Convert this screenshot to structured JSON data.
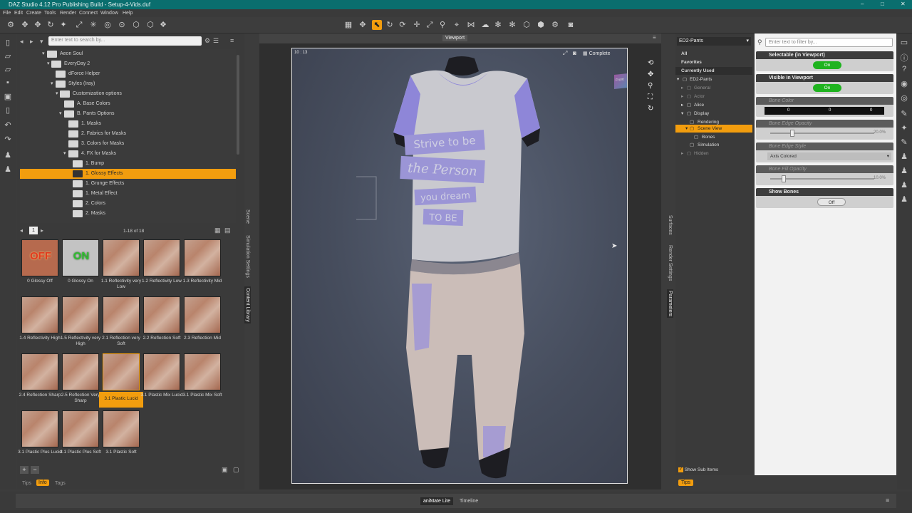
{
  "window": {
    "title": "DAZ Studio 4.12 Pro Publishing Build - Setup-4-Vids.duf",
    "controls": [
      "–",
      "□",
      "✕"
    ]
  },
  "menu": [
    "File",
    "Edit",
    "Create",
    "Tools",
    "Render",
    "Connect",
    "Window",
    "Help"
  ],
  "left_panel": {
    "search_placeholder": "Enter text to search by...",
    "tree": [
      {
        "label": "Aeon Soul",
        "indent": 1
      },
      {
        "label": "EveryDay 2",
        "indent": 2
      },
      {
        "label": "dForce Helper",
        "indent": 3
      },
      {
        "label": "Styles (Iray)",
        "indent": 3
      },
      {
        "label": "Customization options",
        "indent": 4
      },
      {
        "label": "A. Base Colors",
        "indent": 5
      },
      {
        "label": "B. Pants Options",
        "indent": 5
      },
      {
        "label": "1. Masks",
        "indent": 6
      },
      {
        "label": "2. Fabrics for Masks",
        "indent": 6
      },
      {
        "label": "3. Colors for Masks",
        "indent": 6
      },
      {
        "label": "4. FX for Masks",
        "indent": 6
      },
      {
        "label": "1. Bump",
        "indent": 7
      },
      {
        "label": "1. Glossy Effects",
        "indent": 7,
        "selected": true
      },
      {
        "label": "1. Grunge Effects",
        "indent": 7
      },
      {
        "label": "1. Metal Effect",
        "indent": 7
      },
      {
        "label": "2. Colors",
        "indent": 7
      },
      {
        "label": "2. Masks",
        "indent": 7
      }
    ],
    "page": "1",
    "count": "1-18 of 18",
    "thumbs": [
      {
        "label": "0 Glossy Off",
        "badge": "OFF",
        "kind": "off"
      },
      {
        "label": "0 Glossy On",
        "badge": "ON",
        "kind": "on"
      },
      {
        "label": "1.1 Reflectivity very Low"
      },
      {
        "label": "1.2 Reflectivity Low"
      },
      {
        "label": "1.3 Reflectivity Mid"
      },
      {
        "label": "1.4 Reflectivity High"
      },
      {
        "label": "1.5 Reflectivity very High"
      },
      {
        "label": "2.1 Reflection very Soft"
      },
      {
        "label": "2.2 Reflection Soft"
      },
      {
        "label": "2.3 Reflection Mid"
      },
      {
        "label": "2.4 Reflection Sharp"
      },
      {
        "label": "2.5 Reflection Very Sharp"
      },
      {
        "label": "3.1 Plastic Lucid",
        "selected": true
      },
      {
        "label": "3.1 Plastic Mix Lucid"
      },
      {
        "label": "3.1 Plastic Mix Soft"
      },
      {
        "label": "3.1 Plastic Plus Lucid"
      },
      {
        "label": "3.1 Plastic Plus Soft"
      },
      {
        "label": "3.1 Plastic Soft"
      }
    ],
    "bottom_tabs": [
      "Tips",
      "Info",
      "Tags"
    ],
    "vertical_tabs": [
      "Scene",
      "Simulation Settings",
      "Content Library"
    ]
  },
  "viewport": {
    "title": "Viewport",
    "time": "10 : 13",
    "shading": "Complete",
    "shirt_text": [
      "Strive to be",
      "the Person",
      "you dream",
      "TO BE"
    ],
    "cube_label": "Front"
  },
  "right_tabs": [
    "Surfaces",
    "Render Settings",
    "Parameters"
  ],
  "scene": {
    "node": "ED2-Pants",
    "filters": [
      "All",
      "Favorites",
      "Currently Used"
    ],
    "tree": [
      {
        "label": "ED2-Pants"
      },
      {
        "label": "General"
      },
      {
        "label": "Actor"
      },
      {
        "label": "Alice"
      },
      {
        "label": "Display"
      },
      {
        "label": "Rendering"
      },
      {
        "label": "Scene View",
        "selected": true
      },
      {
        "label": "Bones"
      },
      {
        "label": "Simulation"
      },
      {
        "label": "Hidden"
      }
    ],
    "show_sub_items": "Show Sub Items"
  },
  "params": {
    "filter_placeholder": "Enter text to filter by...",
    "items": [
      {
        "title": "Selectable (in Viewport)",
        "value": "On"
      },
      {
        "title": "Visible in Viewport",
        "value": "On"
      },
      {
        "title": "Bone Color",
        "values": [
          "0",
          "0",
          "0"
        ]
      },
      {
        "title": "Bone Edge Opacity",
        "value": "20.0%"
      },
      {
        "title": "Bone Edge Style",
        "value": "Axis Colored"
      },
      {
        "title": "Bone Fill Opacity",
        "value": "10.0%"
      },
      {
        "title": "Show Bones",
        "value": "Off"
      }
    ],
    "tips_tab": "Tips"
  },
  "bottom": {
    "tabs": [
      "aniMate Lite",
      "Timeline"
    ]
  },
  "colors": {
    "accent": "#f29d0e",
    "titlebar": "#0a6e6e",
    "toggle_on": "#1fb31f"
  }
}
